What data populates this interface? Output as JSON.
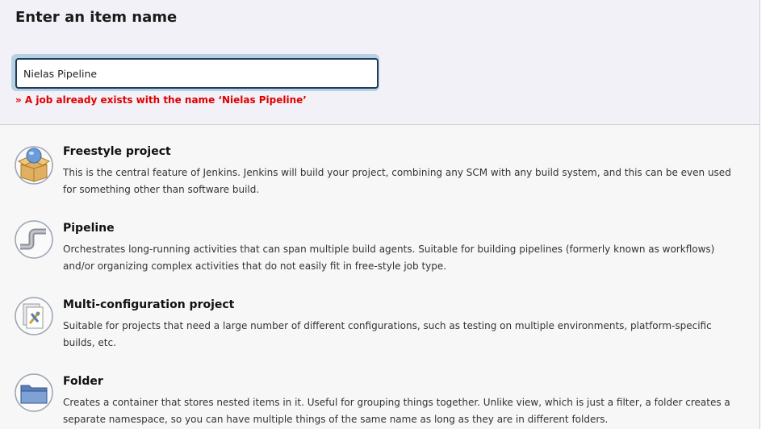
{
  "header": {
    "title": "Enter an item name"
  },
  "name_input": {
    "value": "Nielas Pipeline",
    "error": "» A job already exists with the name ‘Nielas Pipeline’"
  },
  "items": [
    {
      "title": "Freestyle project",
      "description": "This is the central feature of Jenkins. Jenkins will build your project, combining any SCM with any build system, and this can be even used for something other than software build.",
      "icon": "freestyle-project-icon"
    },
    {
      "title": "Pipeline",
      "description": "Orchestrates long-running activities that can span multiple build agents. Suitable for building pipelines (formerly known as workflows) and/or organizing complex activities that do not easily fit in free-style job type.",
      "icon": "pipeline-icon"
    },
    {
      "title": "Multi-configuration project",
      "description": "Suitable for projects that need a large number of different configurations, such as testing on multiple environments, platform-specific builds, etc.",
      "icon": "multi-configuration-icon"
    },
    {
      "title": "Folder",
      "description": "Creates a container that stores nested items in it. Useful for grouping things together. Unlike view, which is just a filter, a folder creates a separate namespace, so you can have multiple things of the same name as long as they are in different folders.",
      "icon": "folder-icon"
    }
  ],
  "colors": {
    "error": "#e00000",
    "header_bg": "#f1f1f7",
    "list_bg": "#f7f7f7",
    "input_border": "#1f3d55"
  }
}
